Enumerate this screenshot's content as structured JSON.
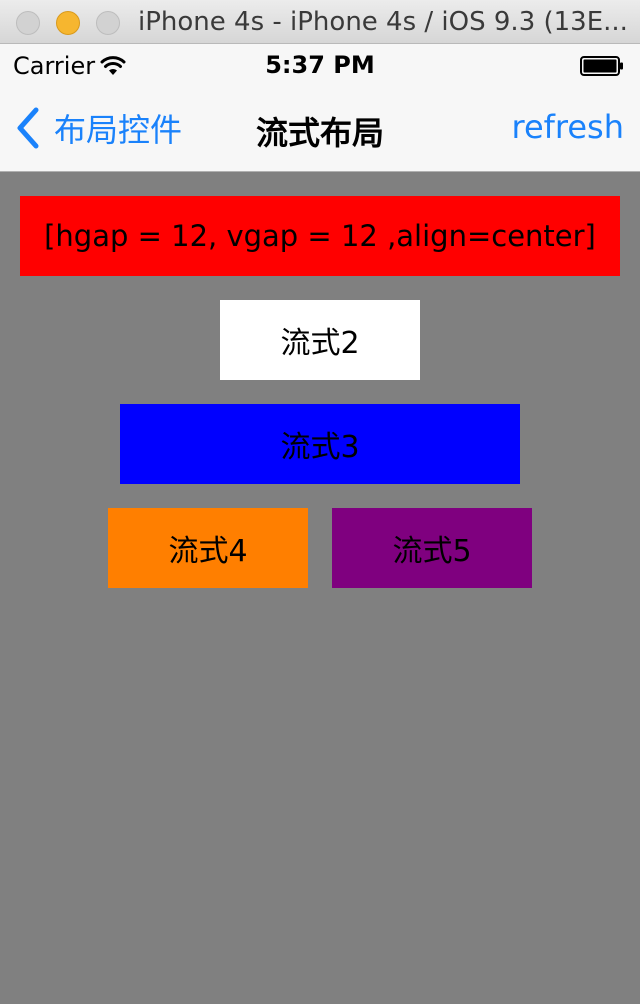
{
  "window": {
    "title": "iPhone 4s - iPhone 4s / iOS 9.3 (13E..."
  },
  "status_bar": {
    "carrier": "Carrier",
    "time": "5:37 PM"
  },
  "nav_bar": {
    "back_label": "布局控件",
    "title": "流式布局",
    "right_button": "refresh",
    "tint_color": "#1a82fb"
  },
  "content": {
    "background": "#808080",
    "items": [
      {
        "label": "[hgap = 12, vgap = 12 ,align=center]",
        "color": "#ff0000"
      },
      {
        "label": "流式2",
        "color": "#ffffff"
      },
      {
        "label": "流式3",
        "color": "#0000ff"
      },
      {
        "label": "流式4",
        "color": "#ff7f00"
      },
      {
        "label": "流式5",
        "color": "#7f007f"
      }
    ]
  }
}
